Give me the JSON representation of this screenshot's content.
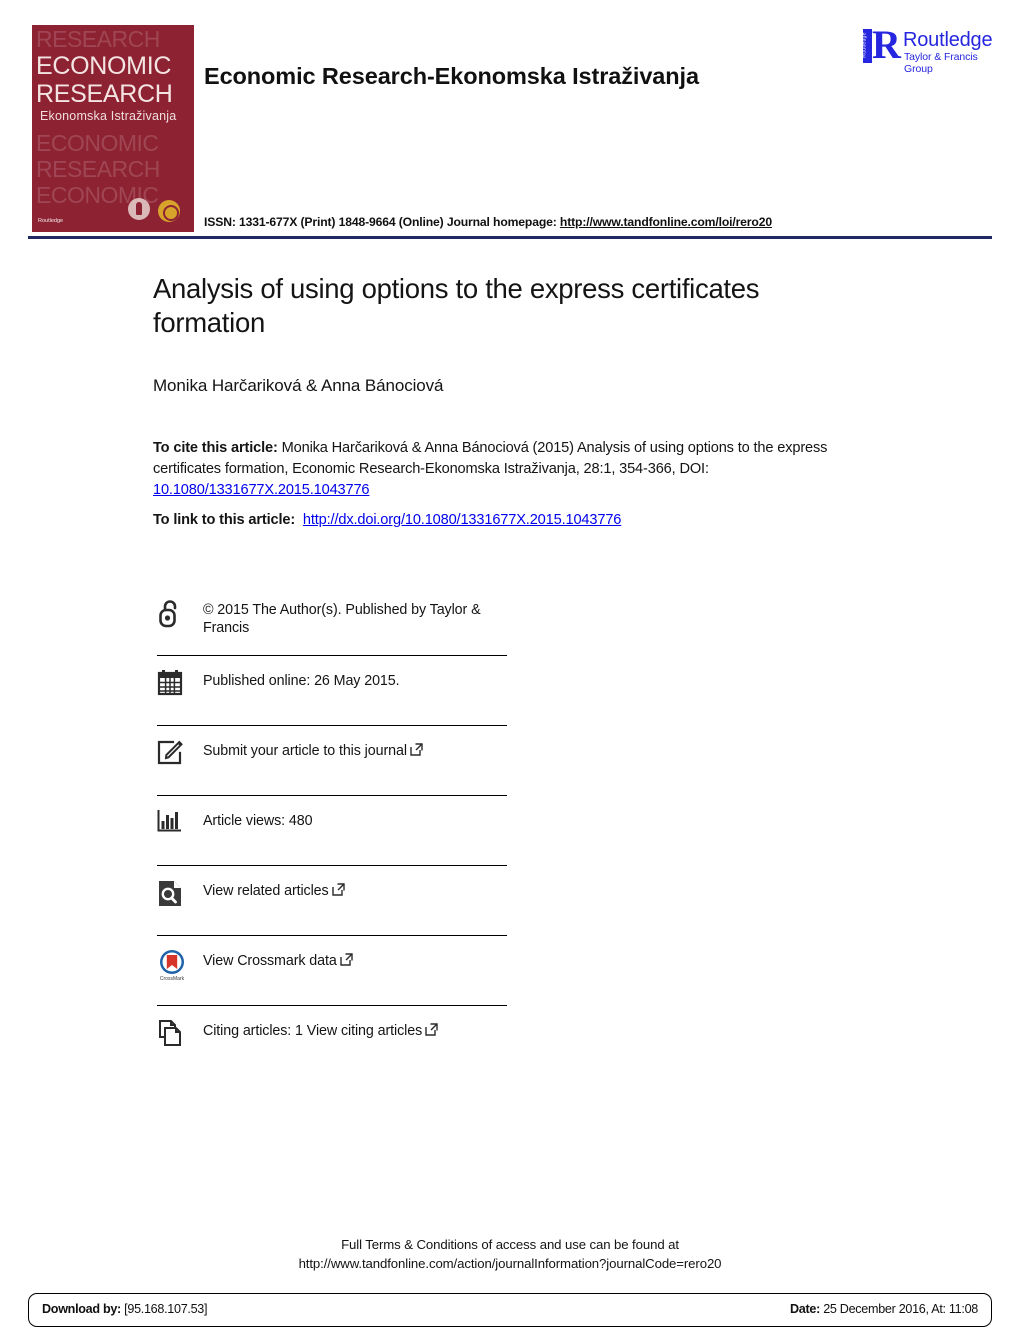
{
  "header": {
    "journal_title": "Economic Research-Ekonomska Istraživanja",
    "cover": {
      "line1": "ECONOMIC",
      "line2": "RESEARCH",
      "subtitle": "Ekonomska Istraživanja",
      "ghost_rows": [
        "RESEARCH",
        "ECONOMIC",
        "RESEARCH",
        "ECONOMIC"
      ],
      "publisher_mark": "Routledge",
      "bg_color": "#8d2233"
    },
    "publisher_logo": {
      "name": "Routledge",
      "tagline": "Taylor & Francis Group",
      "spine_text": "Routledge",
      "color": "#2626e0"
    },
    "issn": {
      "prefix": "ISSN: 1331-677X (Print) 1848-9664 (Online) Journal homepage: ",
      "homepage_url": "http://www.tandfonline.com/loi/rero20"
    },
    "divider_color": "#1f2a63"
  },
  "article": {
    "title": "Analysis of using options to the express certificates formation",
    "authors": "Monika Harčariková & Anna Bánociová",
    "citation": {
      "label": "To cite this article:",
      "text": " Monika Harčariková & Anna Bánociová (2015) Analysis of using options to the express certificates formation, Economic Research-Ekonomska Istraživanja, 28:1, 354-366, DOI: ",
      "doi": "10.1080/1331677X.2015.1043776"
    },
    "link": {
      "label": "To link to this article:",
      "url": "http://dx.doi.org/10.1080/1331677X.2015.1043776"
    }
  },
  "info_rows": [
    {
      "icon": "open-access-icon",
      "text": "© 2015 The Author(s). Published by Taylor & Francis",
      "external": false
    },
    {
      "icon": "calendar-icon",
      "text": "Published online: 26 May 2015.",
      "external": false
    },
    {
      "icon": "submit-article-icon",
      "text": "Submit your article to this journal",
      "external": true
    },
    {
      "icon": "article-views-icon",
      "text": "Article views: 480",
      "external": false
    },
    {
      "icon": "related-articles-icon",
      "text": "View related articles",
      "external": true
    },
    {
      "icon": "crossmark-icon",
      "text": "View Crossmark data",
      "external": true
    },
    {
      "icon": "citing-articles-icon",
      "text": "Citing articles: 1 View citing articles",
      "external": true
    }
  ],
  "footer": {
    "terms_line1": "Full Terms & Conditions of access and use can be found at",
    "terms_line2": "http://www.tandfonline.com/action/journalInformation?journalCode=rero20",
    "download_label": "Download by:",
    "download_value": " [95.168.107.53]",
    "date_label": "Date:",
    "date_value": " 25 December 2016, At: 11:08"
  }
}
